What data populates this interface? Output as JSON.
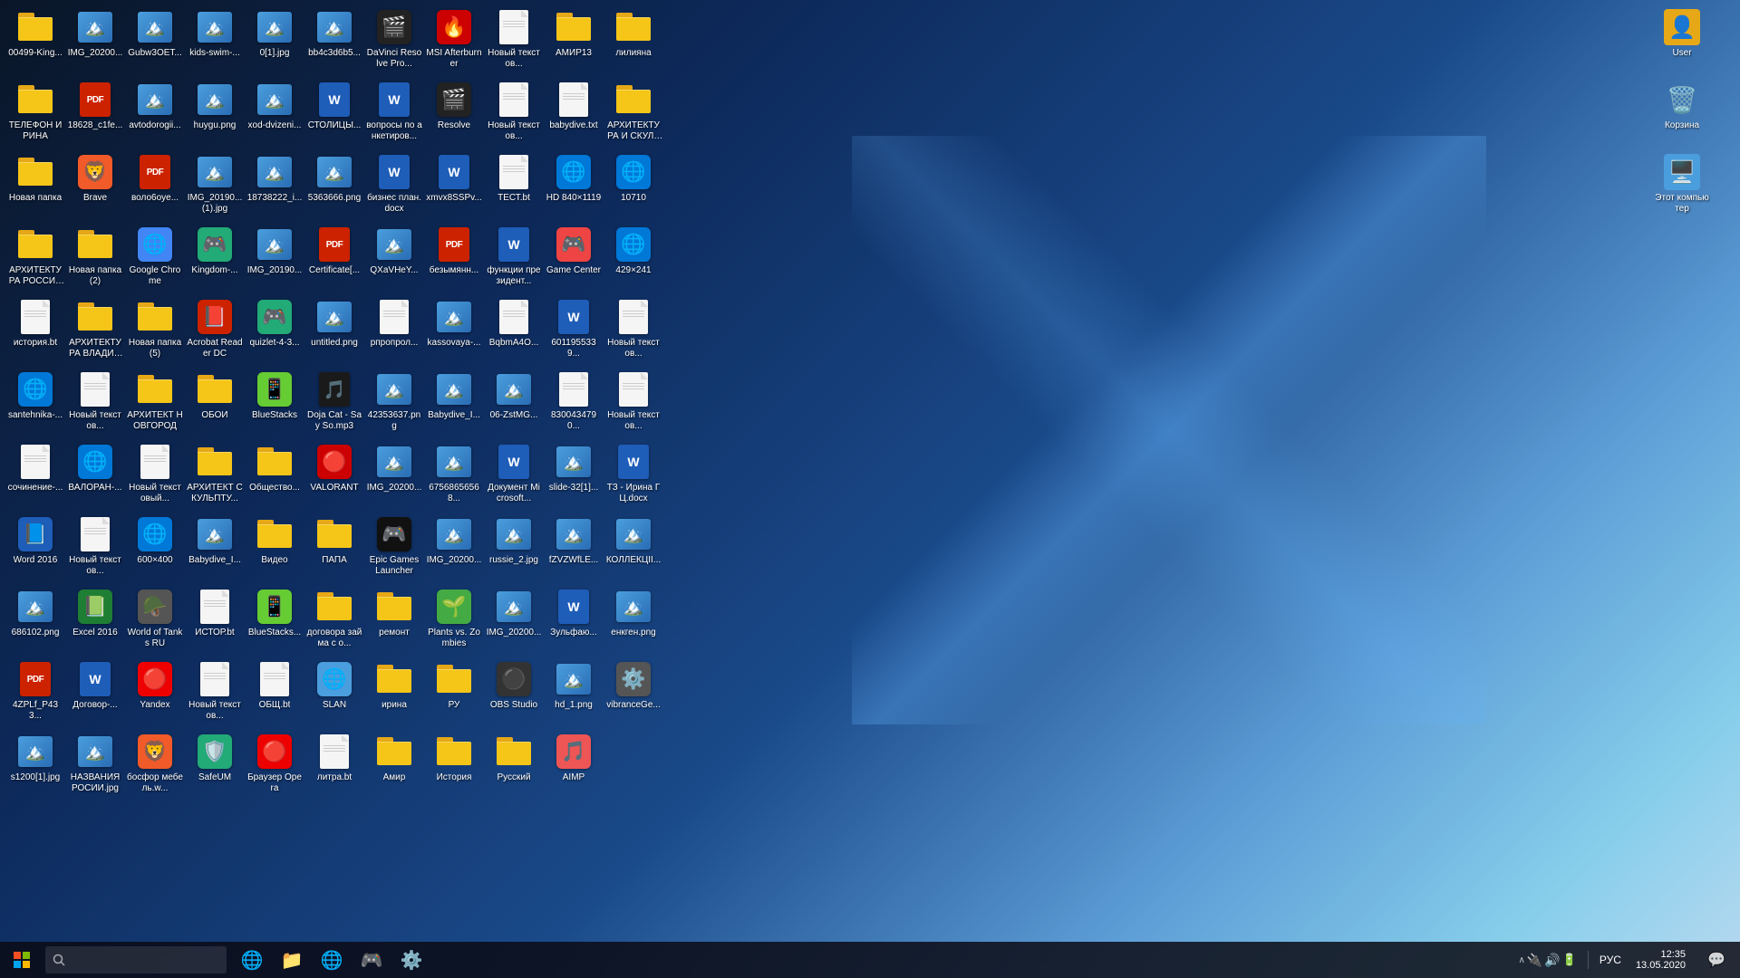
{
  "desktop": {
    "icons": [
      {
        "id": "row1-1",
        "label": "00499-King...",
        "type": "folder",
        "emoji": "📁",
        "color": "#e6a817"
      },
      {
        "id": "row1-2",
        "label": "IMG_20200...",
        "type": "image",
        "emoji": "🖼️",
        "color": "#4a9edd"
      },
      {
        "id": "row1-3",
        "label": "Gubw3OET...",
        "type": "image",
        "emoji": "🖼️",
        "color": "#4a9edd"
      },
      {
        "id": "row1-4",
        "label": "kids-swim-...",
        "type": "image",
        "emoji": "🖼️",
        "color": "#4a9edd"
      },
      {
        "id": "row1-5",
        "label": "0[1].jpg",
        "type": "image",
        "emoji": "🖼️",
        "color": "#4a9edd"
      },
      {
        "id": "row1-6",
        "label": "bb4c3d6b5...",
        "type": "image",
        "emoji": "🖼️",
        "color": "#4a9edd"
      },
      {
        "id": "row1-7",
        "label": "DaVinci Resolve Pro...",
        "type": "app",
        "emoji": "🎬",
        "color": "#222"
      },
      {
        "id": "row1-8",
        "label": "MSI Afterburner",
        "type": "app",
        "emoji": "🔥",
        "color": "#c00"
      },
      {
        "id": "row1-9",
        "label": "Новый текстов...",
        "type": "txt",
        "emoji": "📄",
        "color": "#666"
      },
      {
        "id": "row1-10",
        "label": "АМИР13",
        "type": "folder",
        "emoji": "📁",
        "color": "#e6a817"
      },
      {
        "id": "row1-11",
        "label": "лилияна",
        "type": "folder",
        "emoji": "📁",
        "color": "#e6a817"
      },
      {
        "id": "row1-12",
        "label": "ТЕЛЕФОН ИРИНА",
        "type": "folder",
        "emoji": "📁",
        "color": "#e6a817"
      },
      {
        "id": "row2-1",
        "label": "18628_c1fe...",
        "type": "pdf",
        "emoji": "📕",
        "color": "#cc2200"
      },
      {
        "id": "row2-2",
        "label": "avtodorogii...",
        "type": "image",
        "emoji": "🖼️",
        "color": "#4a9edd"
      },
      {
        "id": "row2-3",
        "label": "huygu.png",
        "type": "image",
        "emoji": "🖼️",
        "color": "#4a9edd"
      },
      {
        "id": "row2-4",
        "label": "xod-dvizeni...",
        "type": "image",
        "emoji": "🖼️",
        "color": "#4a9edd"
      },
      {
        "id": "row2-5",
        "label": "СТОЛИЦЫ...",
        "type": "word",
        "emoji": "📘",
        "color": "#1e5db8"
      },
      {
        "id": "row2-6",
        "label": "вопросы по анкетиров...",
        "type": "word",
        "emoji": "📘",
        "color": "#1e5db8"
      },
      {
        "id": "row2-7",
        "label": "Resolve",
        "type": "app",
        "emoji": "🎬",
        "color": "#222"
      },
      {
        "id": "row2-8",
        "label": "Новый текстов...",
        "type": "txt",
        "emoji": "📄",
        "color": "#666"
      },
      {
        "id": "row2-9",
        "label": "babydive.txt",
        "type": "txt",
        "emoji": "📄",
        "color": "#666"
      },
      {
        "id": "row2-10",
        "label": "АРХИТЕКТУРА И СКУЛЬП...",
        "type": "folder",
        "emoji": "📁",
        "color": "#e6a817"
      },
      {
        "id": "row2-11",
        "label": "Новая папка",
        "type": "folder",
        "emoji": "📁",
        "color": "#e6a817"
      },
      {
        "id": "row2-12",
        "label": "Brave",
        "type": "app",
        "emoji": "🦁",
        "color": "#f15a29"
      },
      {
        "id": "row3-1",
        "label": "воло6oyе...",
        "type": "pdf",
        "emoji": "📕",
        "color": "#cc2200"
      },
      {
        "id": "row3-2",
        "label": "IMG_20190... (1).jpg",
        "type": "image",
        "emoji": "🖼️",
        "color": "#4a9edd"
      },
      {
        "id": "row3-3",
        "label": "18738222_i...",
        "type": "image",
        "emoji": "🖼️",
        "color": "#4a9edd"
      },
      {
        "id": "row3-4",
        "label": "5363666.png",
        "type": "image",
        "emoji": "🖼️",
        "color": "#4a9edd"
      },
      {
        "id": "row3-5",
        "label": "бизнес план.docx",
        "type": "word",
        "emoji": "📘",
        "color": "#1e5db8"
      },
      {
        "id": "row3-6",
        "label": "xmvx8SSPv...",
        "type": "word",
        "emoji": "📘",
        "color": "#1e5db8"
      },
      {
        "id": "row3-7",
        "label": "ТЕСТ.bt",
        "type": "txt",
        "emoji": "📄",
        "color": "#666"
      },
      {
        "id": "row3-8",
        "label": "HD 840×1119",
        "type": "app",
        "emoji": "🌐",
        "color": "#0078d7"
      },
      {
        "id": "row3-9",
        "label": "10710",
        "type": "app",
        "emoji": "🌐",
        "color": "#0078d7"
      },
      {
        "id": "row3-10",
        "label": "АРХИТЕКТУРА РОССИЯ И...",
        "type": "folder",
        "emoji": "📁",
        "color": "#e6a817"
      },
      {
        "id": "row3-11",
        "label": "Новая папка (2)",
        "type": "folder",
        "emoji": "📁",
        "color": "#e6a817"
      },
      {
        "id": "row3-12",
        "label": "Google Chrome",
        "type": "app",
        "emoji": "🌐",
        "color": "#4285f4"
      },
      {
        "id": "row4-1",
        "label": "Kingdom-...",
        "type": "app",
        "emoji": "🎮",
        "color": "#2a7",
        "border-radius": "50%"
      },
      {
        "id": "row4-2",
        "label": "IMG_20190...",
        "type": "image",
        "emoji": "🖼️",
        "color": "#4a9edd"
      },
      {
        "id": "row4-3",
        "label": "Certificate[...",
        "type": "pdf",
        "emoji": "📕",
        "color": "#cc2200"
      },
      {
        "id": "row4-4",
        "label": "QXaVHeY...",
        "type": "image",
        "emoji": "🖼️",
        "color": "#4a9edd"
      },
      {
        "id": "row4-5",
        "label": "безымянн...",
        "type": "pdf",
        "emoji": "📕",
        "color": "#cc2200"
      },
      {
        "id": "row4-6",
        "label": "функции президент...",
        "type": "word",
        "emoji": "📘",
        "color": "#1e5db8"
      },
      {
        "id": "row4-7",
        "label": "Game Center",
        "type": "app",
        "emoji": "🎮",
        "color": "#e44"
      },
      {
        "id": "row4-8",
        "label": "429×241",
        "type": "app",
        "emoji": "🌐",
        "color": "#0078d7"
      },
      {
        "id": "row4-9",
        "label": "история.bt",
        "type": "txt",
        "emoji": "📄",
        "color": "#666"
      },
      {
        "id": "row4-10",
        "label": "АРХИТЕКТУРА ВЛАДИМИР",
        "type": "folder",
        "emoji": "📁",
        "color": "#e6a817"
      },
      {
        "id": "row4-11",
        "label": "Новая папка (5)",
        "type": "folder",
        "emoji": "📁",
        "color": "#e6a817"
      },
      {
        "id": "row4-12",
        "label": "Acrobat Reader DC",
        "type": "app",
        "emoji": "📕",
        "color": "#cc2200"
      },
      {
        "id": "row5-1",
        "label": "quizlet-4-3...",
        "type": "app",
        "emoji": "🎮",
        "color": "#2a7"
      },
      {
        "id": "row5-2",
        "label": "untitled.png",
        "type": "image",
        "emoji": "🖼️",
        "color": "#4a9edd"
      },
      {
        "id": "row5-3",
        "label": "рпропрол...",
        "type": "txt",
        "emoji": "📄",
        "color": "#666"
      },
      {
        "id": "row5-4",
        "label": "kassovaya-...",
        "type": "image",
        "emoji": "🖼️",
        "color": "#4a9edd"
      },
      {
        "id": "row5-5",
        "label": "BqbmA4O...",
        "type": "txt",
        "emoji": "📄",
        "color": "#666"
      },
      {
        "id": "row5-6",
        "label": "6011955339...",
        "type": "word",
        "emoji": "📘",
        "color": "#e44"
      },
      {
        "id": "row5-7",
        "label": "Новый текстов...",
        "type": "txt",
        "emoji": "📄",
        "color": "#666"
      },
      {
        "id": "row5-8",
        "label": "santehnika-...",
        "type": "app",
        "emoji": "🌐",
        "color": "#0078d7"
      },
      {
        "id": "row5-9",
        "label": "Новый текстов...",
        "type": "txt",
        "emoji": "📄",
        "color": "#666"
      },
      {
        "id": "row5-10",
        "label": "АРХИТЕКТ НОВГОРОД",
        "type": "folder",
        "emoji": "📁",
        "color": "#e6a817"
      },
      {
        "id": "row5-11",
        "label": "ОБОИ",
        "type": "folder",
        "emoji": "📁",
        "color": "#e6a817"
      },
      {
        "id": "row5-12",
        "label": "BlueStacks",
        "type": "app",
        "emoji": "📱",
        "color": "#6c3"
      },
      {
        "id": "row6-1",
        "label": "Doja Cat - Say So.mp3",
        "type": "audio",
        "emoji": "🎵",
        "color": "#888"
      },
      {
        "id": "row6-2",
        "label": "42353637.png",
        "type": "image",
        "emoji": "🖼️",
        "color": "#4a9edd"
      },
      {
        "id": "row6-3",
        "label": "Babydive_I...",
        "type": "image",
        "emoji": "🖼️",
        "color": "#4a9edd"
      },
      {
        "id": "row6-4",
        "label": "06-ZstMG...",
        "type": "image",
        "emoji": "🖼️",
        "color": "#4a9edd"
      },
      {
        "id": "row6-5",
        "label": "8300434790...",
        "type": "txt",
        "emoji": "📄",
        "color": "#666"
      },
      {
        "id": "row6-6",
        "label": "Новый текстов...",
        "type": "txt",
        "emoji": "📄",
        "color": "#666"
      },
      {
        "id": "row6-7",
        "label": "сочинение-...",
        "type": "txt",
        "emoji": "📄",
        "color": "#666"
      },
      {
        "id": "row6-8",
        "label": "ВАЛОРАН-...",
        "type": "app",
        "emoji": "🌐",
        "color": "#0078d7"
      },
      {
        "id": "row6-9",
        "label": "Новый текстовый...",
        "type": "txt",
        "emoji": "📄",
        "color": "#666"
      },
      {
        "id": "row6-10",
        "label": "АРХИТЕКТ СКУЛЬПТУ...",
        "type": "folder",
        "emoji": "📁",
        "color": "#e6a817"
      },
      {
        "id": "row6-11",
        "label": "Общество...",
        "type": "folder",
        "emoji": "📁",
        "color": "#e6a817"
      },
      {
        "id": "row6-12",
        "label": "VALORANT",
        "type": "app",
        "emoji": "🔴",
        "color": "#cc0000"
      },
      {
        "id": "row7-1",
        "label": "IMG_20200...",
        "type": "image",
        "emoji": "🖼️",
        "color": "#4a9edd"
      },
      {
        "id": "row7-2",
        "label": "67568656568...",
        "type": "image",
        "emoji": "🖼️",
        "color": "#4a9edd"
      },
      {
        "id": "row7-3",
        "label": "Документ Microsoft...",
        "type": "word",
        "emoji": "📘",
        "color": "#1e5db8"
      },
      {
        "id": "row7-4",
        "label": "slide-32[1]...",
        "type": "image",
        "emoji": "🖼️",
        "color": "#4a9edd"
      },
      {
        "id": "row7-5",
        "label": "ТЗ - Ирина ГЦ.docx",
        "type": "word",
        "emoji": "📘",
        "color": "#1e5db8"
      },
      {
        "id": "row7-6",
        "label": "Word 2016",
        "type": "app",
        "emoji": "📘",
        "color": "#1e5db8"
      },
      {
        "id": "row7-7",
        "label": "Новый текстов...",
        "type": "txt",
        "emoji": "📄",
        "color": "#666"
      },
      {
        "id": "row7-8",
        "label": "600×400",
        "type": "app",
        "emoji": "🌐",
        "color": "#0078d7"
      },
      {
        "id": "row7-9",
        "label": "Babydive_I...",
        "type": "image",
        "emoji": "🖼️",
        "color": "#4a9edd"
      },
      {
        "id": "row7-10",
        "label": "Видео",
        "type": "folder",
        "emoji": "📁",
        "color": "#e6a817"
      },
      {
        "id": "row7-11",
        "label": "ПАПА",
        "type": "folder",
        "emoji": "📁",
        "color": "#e6a817"
      },
      {
        "id": "row7-12",
        "label": "Epic Games Launcher",
        "type": "app",
        "emoji": "🎮",
        "color": "#111"
      },
      {
        "id": "row8-1",
        "label": "IMG_20200...",
        "type": "image",
        "emoji": "🖼️",
        "color": "#4a9edd"
      },
      {
        "id": "row8-2",
        "label": "russie_2.jpg",
        "type": "image",
        "emoji": "🖼️",
        "color": "#4a9edd"
      },
      {
        "id": "row8-3",
        "label": "fZVZWfLE...",
        "type": "image",
        "emoji": "🖼️",
        "color": "#4a9edd"
      },
      {
        "id": "row8-4",
        "label": "КОЛЛЕКЦII...",
        "type": "image",
        "emoji": "🖼️",
        "color": "#4a9edd"
      },
      {
        "id": "row8-5",
        "label": "686102.png",
        "type": "image",
        "emoji": "🖼️",
        "color": "#4a9edd"
      },
      {
        "id": "row8-6",
        "label": "Excel 2016",
        "type": "app",
        "emoji": "📗",
        "color": "#1e7e34"
      },
      {
        "id": "row8-7",
        "label": "World of Tanks RU",
        "type": "app",
        "emoji": "🪖",
        "color": "#555"
      },
      {
        "id": "row8-8",
        "label": "ИСТОР.bt",
        "type": "txt",
        "emoji": "📄",
        "color": "#666"
      },
      {
        "id": "row8-9",
        "label": "BlueStacks...",
        "type": "app",
        "emoji": "📱",
        "color": "#6c3"
      },
      {
        "id": "row8-10",
        "label": "договора займа с о...",
        "type": "folder",
        "emoji": "📁",
        "color": "#e6a817"
      },
      {
        "id": "row8-11",
        "label": "ремонт",
        "type": "folder",
        "emoji": "📁",
        "color": "#e6a817"
      },
      {
        "id": "row8-12",
        "label": "Plants vs. Zombies",
        "type": "app",
        "emoji": "🌱",
        "color": "#4a4"
      },
      {
        "id": "row9-1",
        "label": "IMG_20200...",
        "type": "image",
        "emoji": "🖼️",
        "color": "#4a9edd"
      },
      {
        "id": "row9-2",
        "label": "Зульфаю...",
        "type": "word",
        "emoji": "📘",
        "color": "#1e5db8"
      },
      {
        "id": "row9-3",
        "label": "енкген.png",
        "type": "image",
        "emoji": "🖼️",
        "color": "#4a9edd"
      },
      {
        "id": "row9-4",
        "label": "4ZPLf_P433...",
        "type": "pdf",
        "emoji": "📕",
        "color": "#cc2200"
      },
      {
        "id": "row9-5",
        "label": "Договор-...",
        "type": "word",
        "emoji": "📘",
        "color": "#1e5db8"
      },
      {
        "id": "row9-6",
        "label": "Yandex",
        "type": "app",
        "emoji": "🔴",
        "color": "#e00"
      },
      {
        "id": "row9-7",
        "label": "Новый текстов...",
        "type": "txt",
        "emoji": "📄",
        "color": "#666"
      },
      {
        "id": "row9-8",
        "label": "ОБЩ.bt",
        "type": "txt",
        "emoji": "📄",
        "color": "#666"
      },
      {
        "id": "row9-9",
        "label": "SLAN",
        "type": "app",
        "emoji": "🌐",
        "color": "#4a9edd"
      },
      {
        "id": "row9-10",
        "label": "ирина",
        "type": "folder",
        "emoji": "📁",
        "color": "#e6a817"
      },
      {
        "id": "row9-11",
        "label": "РУ",
        "type": "folder",
        "emoji": "📁",
        "color": "#e6a817"
      },
      {
        "id": "row9-12",
        "label": "OBS Studio",
        "type": "app",
        "emoji": "⚫",
        "color": "#333"
      },
      {
        "id": "row10-1",
        "label": "hd_1.png",
        "type": "image",
        "emoji": "🖼️",
        "color": "#4a9edd"
      },
      {
        "id": "row10-2",
        "label": "vibranceGe...",
        "type": "app",
        "emoji": "⚙️",
        "color": "#555"
      },
      {
        "id": "row10-3",
        "label": "s1200[1].jpg",
        "type": "image",
        "emoji": "🖼️",
        "color": "#4a9edd"
      },
      {
        "id": "row10-4",
        "label": "НАЗВАНИЯ РОСИИ.jpg",
        "type": "image",
        "emoji": "🖼️",
        "color": "#4a9edd"
      },
      {
        "id": "row10-5",
        "label": "босфор мебель.w...",
        "type": "app",
        "emoji": "🦁",
        "color": "#f15a29"
      },
      {
        "id": "row10-6",
        "label": "SafeUM",
        "type": "app",
        "emoji": "🛡️",
        "color": "#2a7"
      },
      {
        "id": "row10-7",
        "label": "Браузер Opera",
        "type": "app",
        "emoji": "🔴",
        "color": "#e00"
      },
      {
        "id": "row10-8",
        "label": "литра.bt",
        "type": "txt",
        "emoji": "📄",
        "color": "#666"
      },
      {
        "id": "row10-9",
        "label": "Амир",
        "type": "folder",
        "emoji": "📁",
        "color": "#e6a817"
      },
      {
        "id": "row10-10",
        "label": "История",
        "type": "folder",
        "emoji": "📁",
        "color": "#e6a817"
      },
      {
        "id": "row10-11",
        "label": "Русский",
        "type": "folder",
        "emoji": "📁",
        "color": "#e6a817"
      },
      {
        "id": "row10-12",
        "label": "AIMP",
        "type": "app",
        "emoji": "🎵",
        "color": "#e55"
      }
    ],
    "rightIcons": [
      {
        "id": "r1",
        "label": "User",
        "emoji": "👤",
        "color": "#e6a817"
      },
      {
        "id": "r2",
        "label": "Корзина",
        "emoji": "🗑️",
        "color": "#aaa"
      },
      {
        "id": "r3",
        "label": "Этот компьютер",
        "emoji": "🖥️",
        "color": "#4a9edd"
      }
    ]
  },
  "taskbar": {
    "time": "12:35",
    "date": "13.05.2020",
    "language": "РУС",
    "apps": [
      {
        "id": "tb-edge",
        "emoji": "🌐",
        "label": "Edge"
      },
      {
        "id": "tb-explorer",
        "emoji": "📁",
        "label": "Explorer"
      },
      {
        "id": "tb-chrome",
        "emoji": "🌐",
        "label": "Chrome"
      },
      {
        "id": "tb-steam",
        "emoji": "🎮",
        "label": "Steam"
      },
      {
        "id": "tb-settings",
        "emoji": "⚙️",
        "label": "Settings"
      }
    ]
  }
}
